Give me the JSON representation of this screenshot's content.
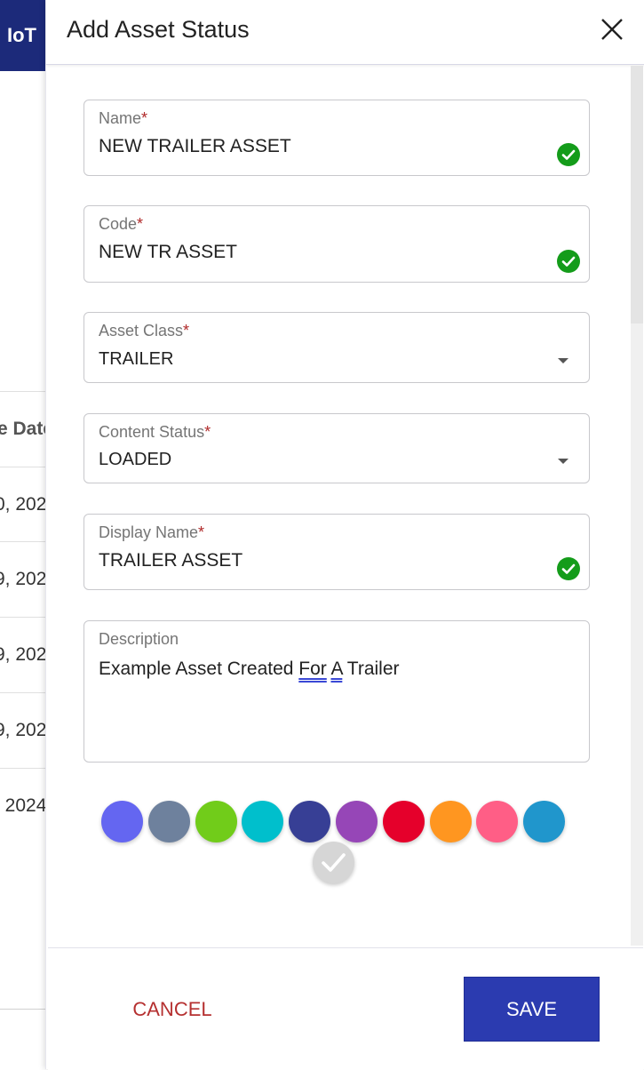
{
  "background": {
    "brand": "IoT",
    "table_header": "e Date",
    "rows": [
      "0, 202",
      "9, 202",
      "9, 202",
      "9, 202",
      ", 2024"
    ]
  },
  "drawer": {
    "title": "Add Asset Status",
    "close_icon": "close-icon"
  },
  "form": {
    "name": {
      "label": "Name",
      "required": "*",
      "value": "NEW TRAILER ASSET",
      "valid": true
    },
    "code": {
      "label": "Code",
      "required": "*",
      "value": "NEW TR ASSET",
      "valid": true
    },
    "asset_class": {
      "label": "Asset Class",
      "required": "*",
      "value": "TRAILER"
    },
    "content_status": {
      "label": "Content Status",
      "required": "*",
      "value": "LOADED"
    },
    "display_name": {
      "label": "Display Name",
      "required": "*",
      "value": "TRAILER ASSET",
      "valid": true
    },
    "description": {
      "label": "Description",
      "text_before": "Example Asset Created ",
      "word_1": "For",
      "space": " ",
      "word_2": "A",
      "text_after": " Trailer"
    }
  },
  "colors": {
    "swatches": [
      "#6466f1",
      "#6e819d",
      "#71cc1a",
      "#00bfcc",
      "#373f95",
      "#9646b7",
      "#e5002b",
      "#ff9620",
      "#ff5e86",
      "#2096cc",
      "#d6d6d6"
    ],
    "selected_index": 10,
    "check_green": "#149c1a",
    "primary": "#2b3bb0",
    "cancel": "#b53030"
  },
  "actions": {
    "cancel": "CANCEL",
    "save": "SAVE"
  }
}
